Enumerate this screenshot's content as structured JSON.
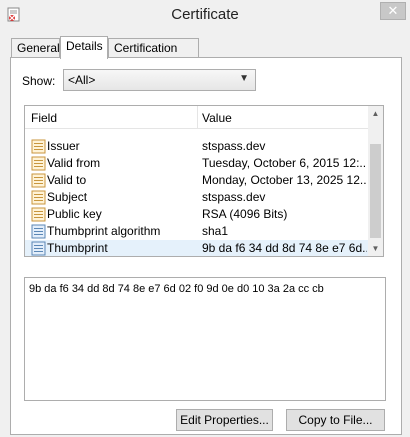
{
  "window": {
    "title": "Certificate"
  },
  "tabs": [
    {
      "label": "General"
    },
    {
      "label": "Details"
    },
    {
      "label": "Certification Path"
    }
  ],
  "show": {
    "label": "Show:",
    "selected": "<All>"
  },
  "list": {
    "headers": {
      "field": "Field",
      "value": "Value"
    },
    "rows": [
      {
        "field": "Issuer",
        "value": "stspass.dev",
        "icon": "certificate-field-icon"
      },
      {
        "field": "Valid from",
        "value": "Tuesday, October 6, 2015 12:...",
        "icon": "certificate-field-icon"
      },
      {
        "field": "Valid to",
        "value": "Monday, October 13, 2025 12...",
        "icon": "certificate-field-icon"
      },
      {
        "field": "Subject",
        "value": "stspass.dev",
        "icon": "certificate-field-icon"
      },
      {
        "field": "Public key",
        "value": "RSA (4096 Bits)",
        "icon": "certificate-field-icon"
      },
      {
        "field": "Thumbprint algorithm",
        "value": "sha1",
        "icon": "certificate-property-icon"
      },
      {
        "field": "Thumbprint",
        "value": "9b da f6 34 dd 8d 74 8e e7 6d...",
        "icon": "certificate-property-icon"
      }
    ]
  },
  "detail": {
    "text": "9b da f6 34 dd 8d 74 8e e7 6d 02 f0 9d 0e d0 10 3a 2a cc cb"
  },
  "buttons": {
    "edit_properties": "Edit Properties...",
    "copy_to_file": "Copy to File..."
  }
}
